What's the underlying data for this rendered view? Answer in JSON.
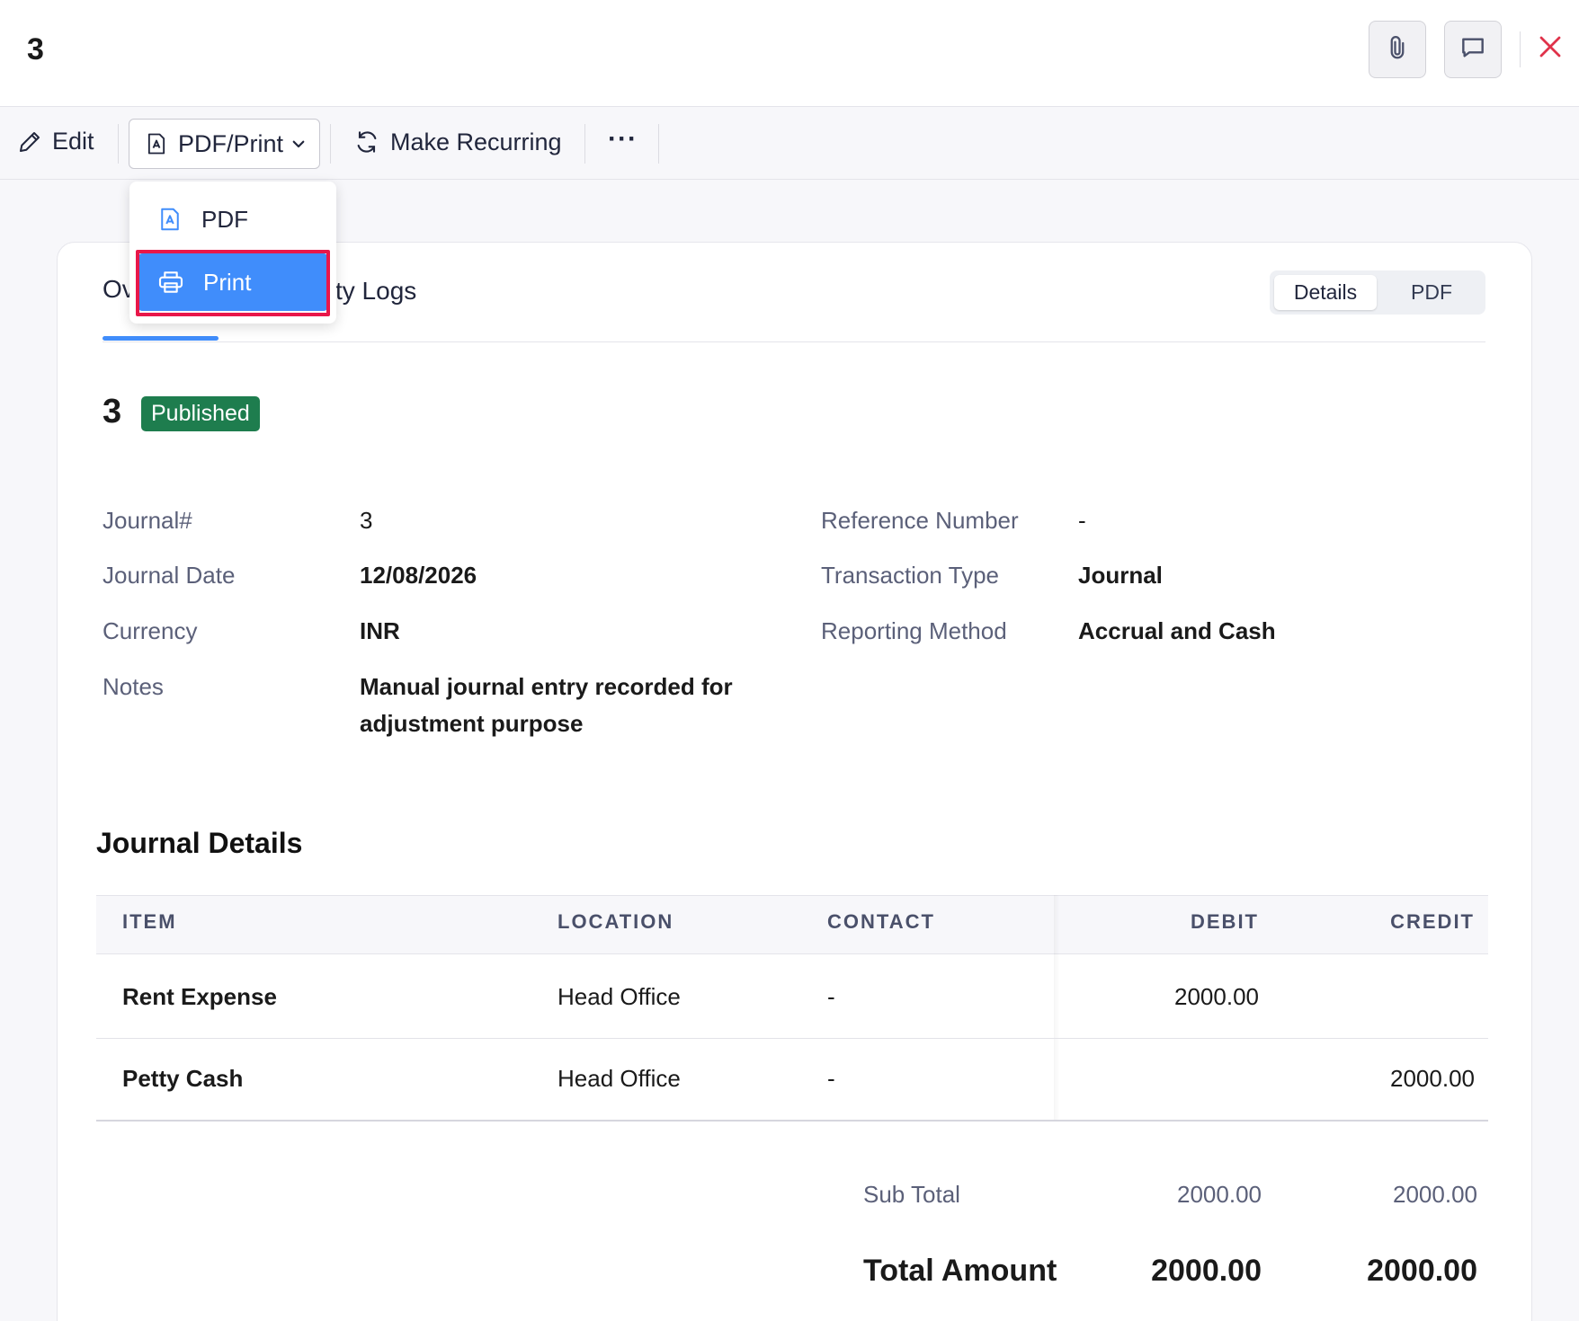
{
  "header": {
    "title": "3"
  },
  "toolbar": {
    "edit_label": "Edit",
    "pdf_print_label": "PDF/Print",
    "make_recurring_label": "Make Recurring",
    "more_label": "···"
  },
  "dropdown": {
    "items": [
      {
        "label": "PDF",
        "icon": "pdf-icon"
      },
      {
        "label": "Print",
        "icon": "printer-icon",
        "selected": true
      }
    ]
  },
  "tabs": {
    "overview_partial": "Ov",
    "activity_partial": "ty Logs"
  },
  "view_toggle": {
    "details": "Details",
    "pdf": "PDF"
  },
  "journal": {
    "number": "3",
    "status": "Published",
    "fields_left": [
      {
        "label": "Journal#",
        "value": "3"
      },
      {
        "label": "Journal Date",
        "value": "12/08/2026"
      },
      {
        "label": "Currency",
        "value": "INR"
      },
      {
        "label": "Notes",
        "value_line1": "Manual journal entry recorded for",
        "value_line2": "adjustment purpose"
      }
    ],
    "fields_right": [
      {
        "label": "Reference Number",
        "value": "-"
      },
      {
        "label": "Transaction Type",
        "value": "Journal"
      },
      {
        "label": "Reporting Method",
        "value": "Accrual and Cash"
      }
    ]
  },
  "details": {
    "title": "Journal Details",
    "columns": [
      "ITEM",
      "LOCATION",
      "CONTACT",
      "DEBIT",
      "CREDIT"
    ],
    "rows": [
      {
        "item": "Rent Expense",
        "location": "Head Office",
        "contact": "-",
        "debit": "2000.00",
        "credit": ""
      },
      {
        "item": "Petty Cash",
        "location": "Head Office",
        "contact": "-",
        "debit": "",
        "credit": "2000.00"
      }
    ],
    "subtotal": {
      "label": "Sub Total",
      "debit": "2000.00",
      "credit": "2000.00"
    },
    "total": {
      "label": "Total Amount",
      "debit": "2000.00",
      "credit": "2000.00"
    }
  },
  "colors": {
    "accent": "#408dfb",
    "published": "#1e7d4e",
    "highlight": "#e8174a",
    "close": "#e0324a"
  }
}
